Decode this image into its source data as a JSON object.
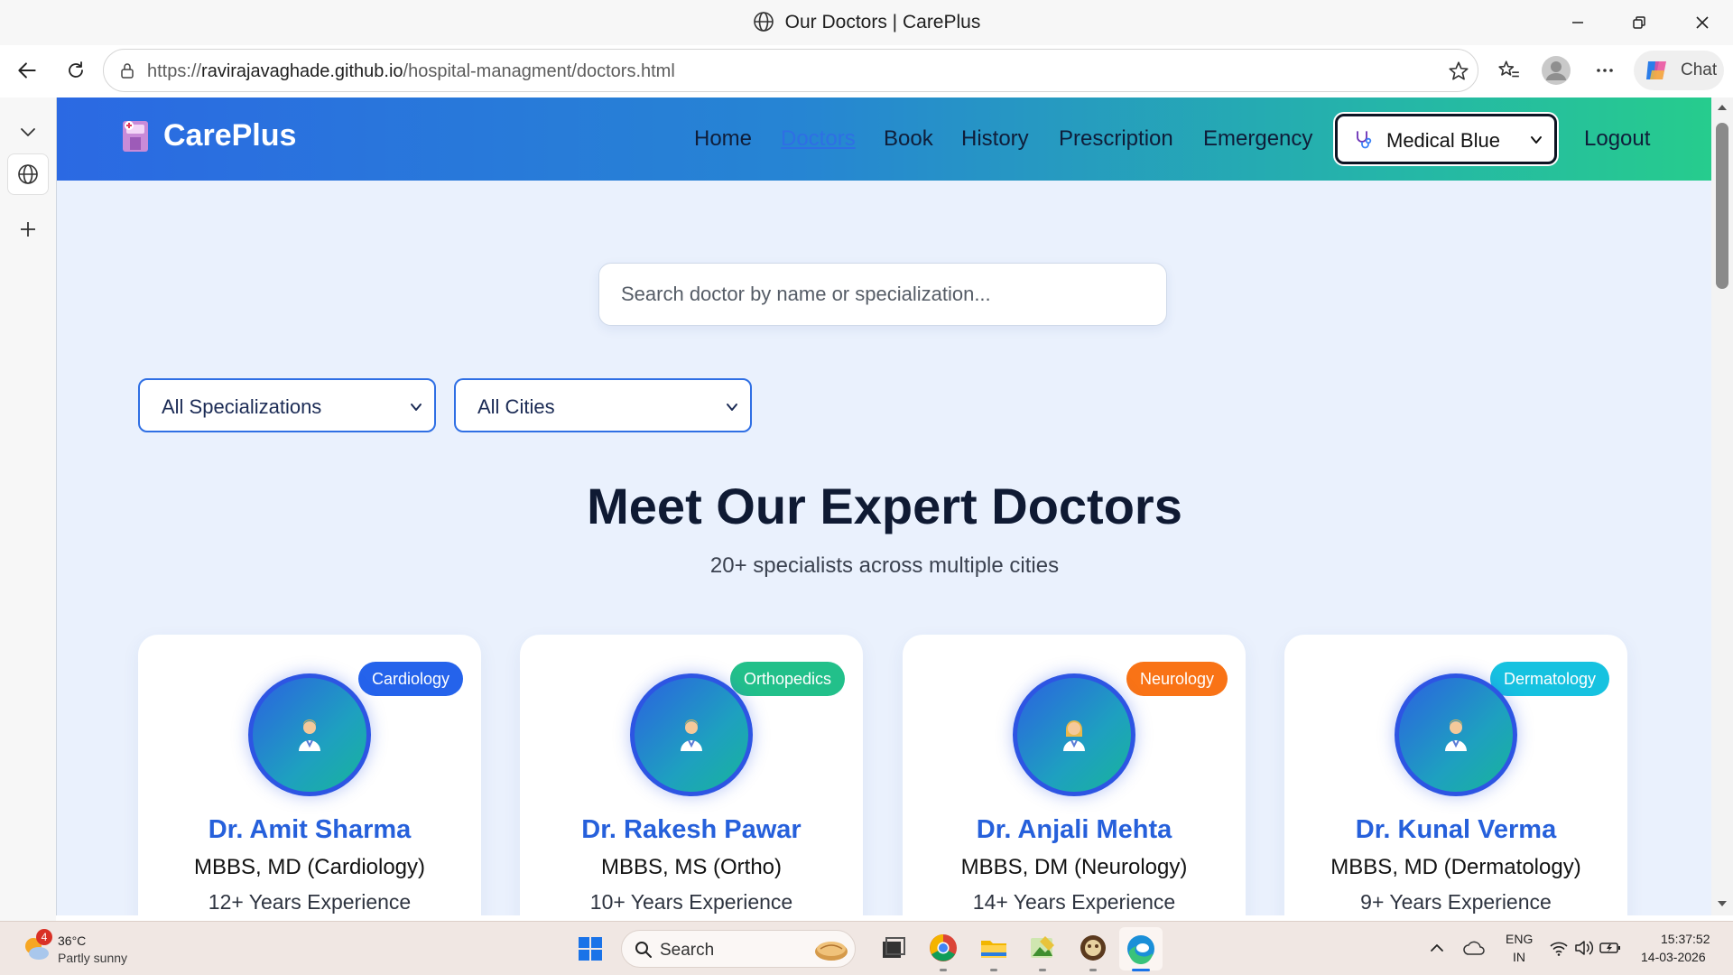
{
  "browser": {
    "tab_title": "Our Doctors | CarePlus",
    "url_prefix": "https://",
    "url_domain": "ravirajavaghade.github.io",
    "url_path": "/hospital-managment/doctors.html",
    "chat_label": "Chat"
  },
  "site": {
    "brand": "CarePlus",
    "nav": [
      {
        "label": "Home"
      },
      {
        "label": "Doctors"
      },
      {
        "label": "Book"
      },
      {
        "label": "History"
      },
      {
        "label": "Prescription"
      },
      {
        "label": "Emergency"
      }
    ],
    "theme_selected": "Medical Blue",
    "logout_label": "Logout"
  },
  "search": {
    "placeholder": "Search doctor by name or specialization..."
  },
  "filters": {
    "specialization": "All Specializations",
    "city": "All Cities"
  },
  "section": {
    "title": "Meet Our Expert Doctors",
    "subtitle": "20+ specialists across multiple cities"
  },
  "doctors": [
    {
      "name": "Dr. Amit Sharma",
      "degree": "MBBS, MD (Cardiology)",
      "experience": "12+ Years Experience",
      "specialization": "Cardiology",
      "badge_color": "#2563eb"
    },
    {
      "name": "Dr. Rakesh Pawar",
      "degree": "MBBS, MS (Ortho)",
      "experience": "10+ Years Experience",
      "specialization": "Orthopedics",
      "badge_color": "#22c08a"
    },
    {
      "name": "Dr. Anjali Mehta",
      "degree": "MBBS, DM (Neurology)",
      "experience": "14+ Years Experience",
      "specialization": "Neurology",
      "badge_color": "#f97316"
    },
    {
      "name": "Dr. Kunal Verma",
      "degree": "MBBS, MD (Dermatology)",
      "experience": "9+ Years Experience",
      "specialization": "Dermatology",
      "badge_color": "#16c2e0"
    }
  ],
  "taskbar": {
    "weather_badge": "4",
    "temperature": "36°C",
    "condition": "Partly sunny",
    "search_label": "Search",
    "lang_top": "ENG",
    "lang_bottom": "IN",
    "time": "15:37:52",
    "date": "14-03-2026"
  }
}
